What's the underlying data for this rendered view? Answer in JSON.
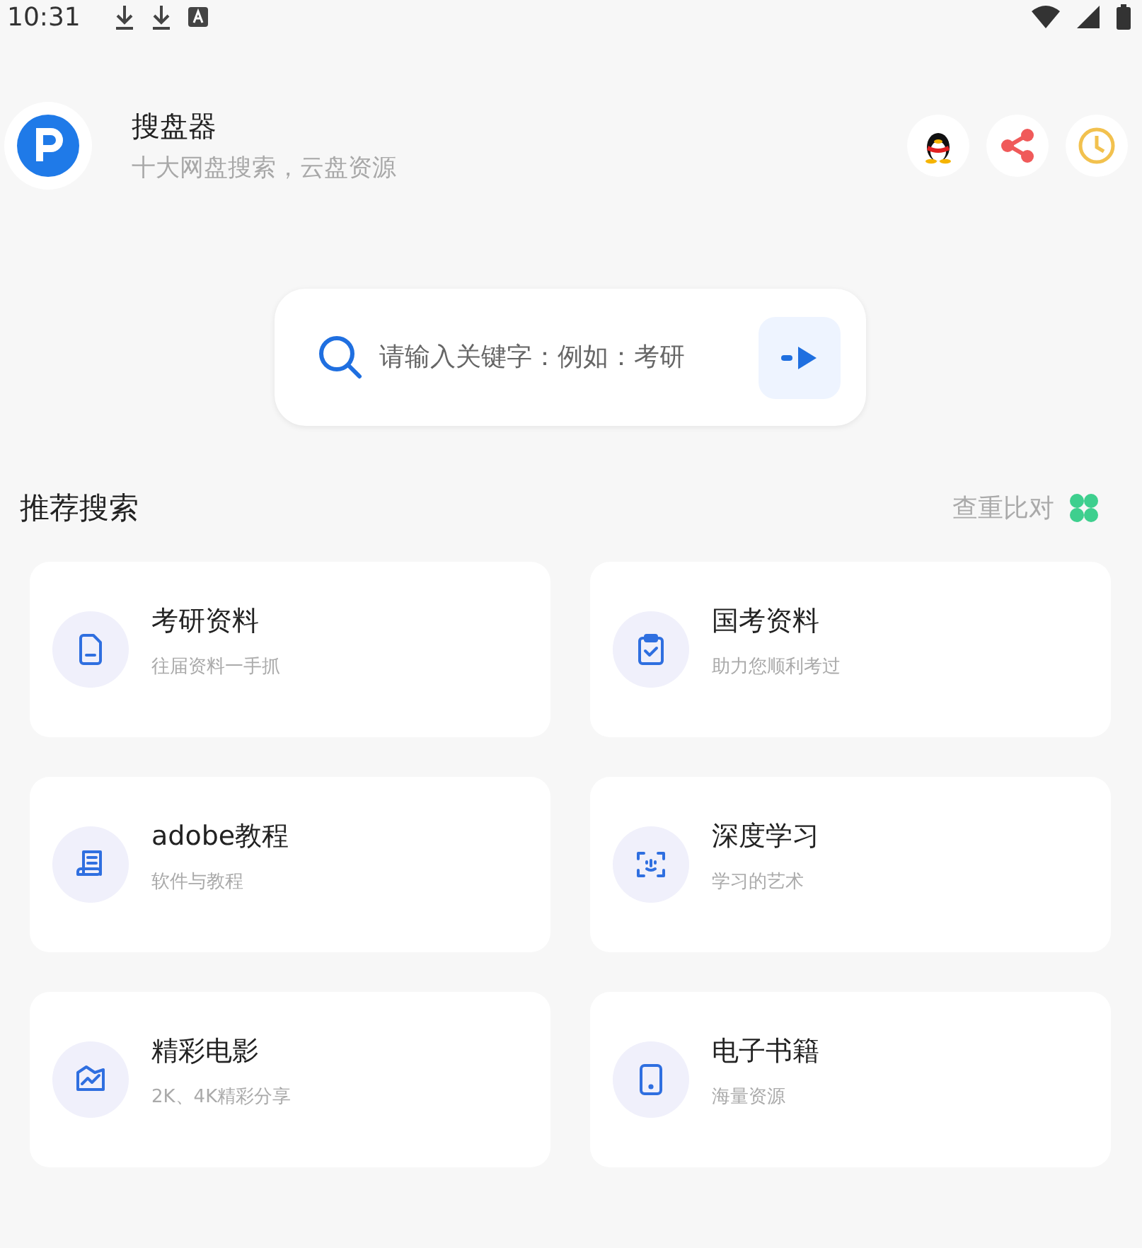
{
  "status_bar": {
    "time": "10:31"
  },
  "header": {
    "title": "搜盘器",
    "subtitle": "十大网盘搜索，云盘资源"
  },
  "search": {
    "placeholder": "请输入关键字：例如：考研"
  },
  "section": {
    "title": "推荐搜索",
    "action": "查重比对"
  },
  "categories": [
    {
      "title": "考研资料",
      "subtitle": "往届资料一手抓"
    },
    {
      "title": "国考资料",
      "subtitle": "助力您顺利考过"
    },
    {
      "title": "adobe教程",
      "subtitle": "软件与教程"
    },
    {
      "title": "深度学习",
      "subtitle": "学习的艺术"
    },
    {
      "title": "精彩电影",
      "subtitle": "2K、4K精彩分享"
    },
    {
      "title": "电子书籍",
      "subtitle": "海量资源"
    }
  ]
}
